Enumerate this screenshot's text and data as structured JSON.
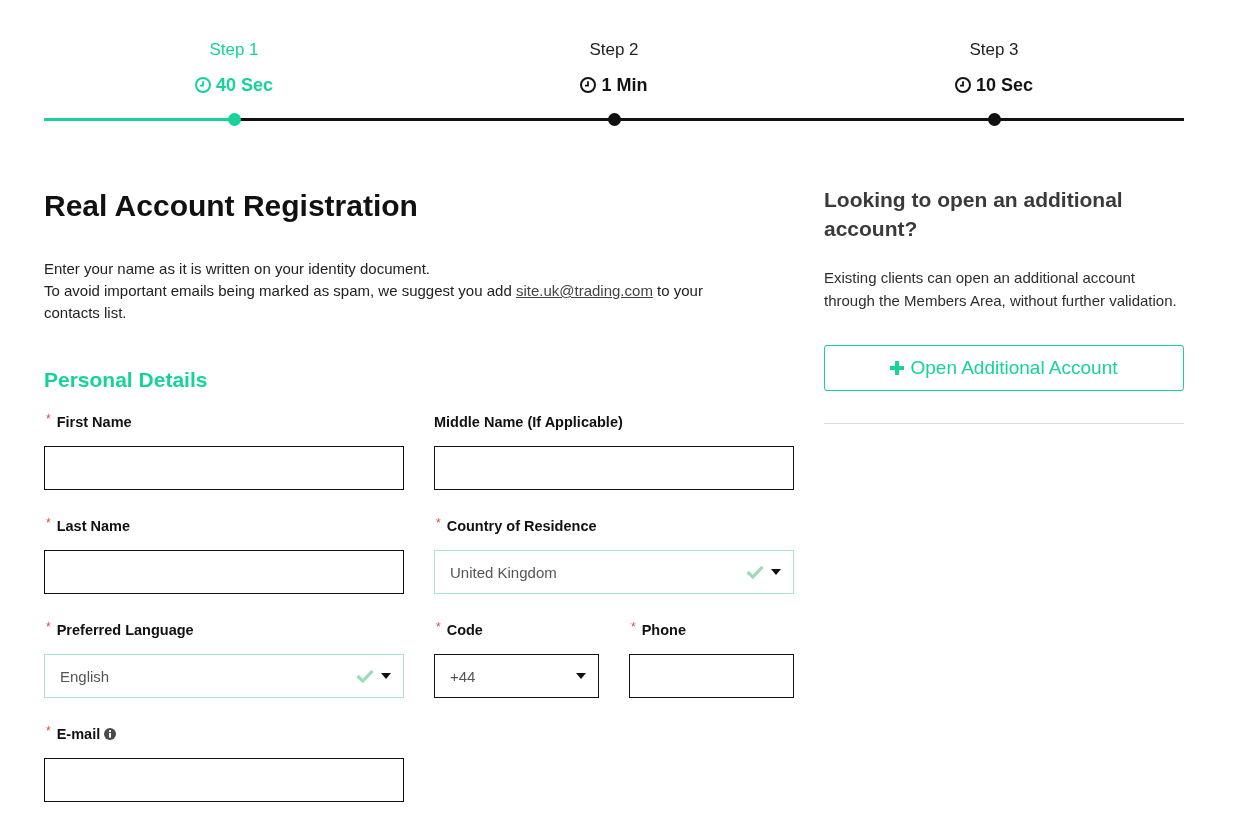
{
  "steps": [
    {
      "label": "Step 1",
      "duration": "40 Sec",
      "selected": true
    },
    {
      "label": "Step 2",
      "duration": "1 Min",
      "selected": false
    },
    {
      "label": "Step 3",
      "duration": "10 Sec",
      "selected": false
    }
  ],
  "registration": {
    "title": "Real Account Registration",
    "intro": [
      {
        "text": "Enter your name as it is written on your identity document."
      },
      {
        "text": "To avoid important emails being marked as spam, we suggest you add ",
        "link": "site.uk@trading.com",
        "text_after": " to your contacts list."
      }
    ],
    "section_title": "Personal Details",
    "required_mark": "*",
    "fields": [
      {
        "kind": "text",
        "label": "First Name",
        "required": true
      },
      {
        "kind": "text",
        "label": "Middle Name (If Applicable)",
        "required": false
      },
      {
        "kind": "text",
        "label": "Last Name",
        "required": true
      },
      {
        "kind": "select",
        "label": "Country of Residence",
        "required": true,
        "value": "United Kingdom",
        "valid": true
      },
      {
        "kind": "select",
        "label": "Preferred Language",
        "required": true,
        "value": "English",
        "valid": true
      },
      {
        "kind": "group",
        "parts": [
          {
            "kind": "select",
            "label": "Code",
            "required": true,
            "value": "+44",
            "valid": false
          },
          {
            "kind": "text",
            "label": "Phone",
            "required": true
          }
        ]
      },
      {
        "kind": "text",
        "label": "E-mail",
        "required": true,
        "info": true
      }
    ]
  },
  "sidebar": {
    "title": "Looking to open an additional account?",
    "text": "Existing clients can open an additional account through the Members Area, without further validation.",
    "button": {
      "label": "Open Additional Account"
    }
  }
}
